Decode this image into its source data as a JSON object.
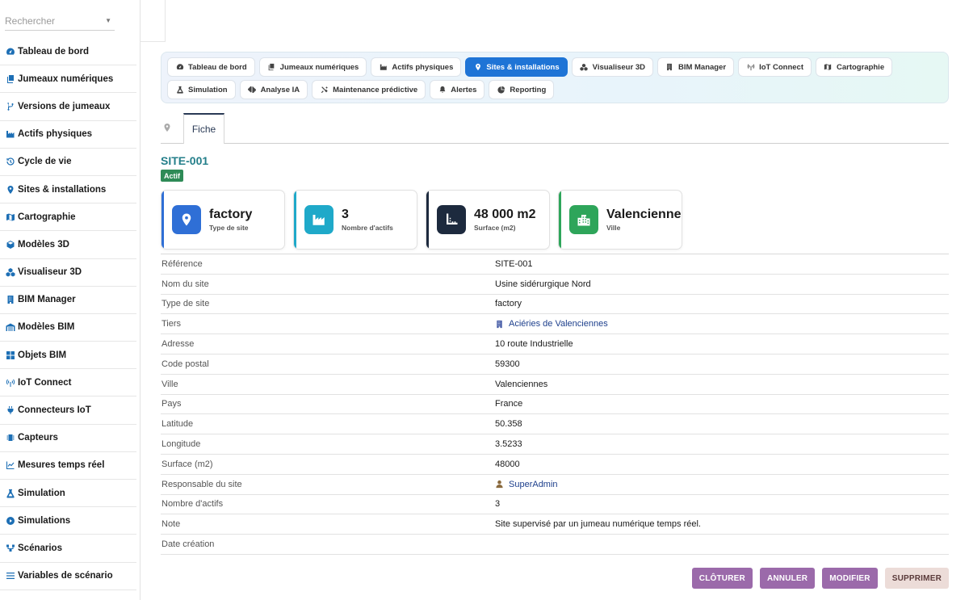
{
  "sidebar": {
    "search_placeholder": "Rechercher",
    "items": [
      {
        "label": "Tableau de bord",
        "icon": "gauge-icon"
      },
      {
        "label": "Jumeaux numériques",
        "icon": "copy-icon"
      },
      {
        "label": "Versions de jumeaux",
        "icon": "branch-icon"
      },
      {
        "label": "Actifs physiques",
        "icon": "industry-icon"
      },
      {
        "label": "Cycle de vie",
        "icon": "history-icon"
      },
      {
        "label": "Sites & installations",
        "icon": "map-pin-icon"
      },
      {
        "label": "Cartographie",
        "icon": "map-icon"
      },
      {
        "label": "Modèles 3D",
        "icon": "cube-icon"
      },
      {
        "label": "Visualiseur 3D",
        "icon": "cubes-icon"
      },
      {
        "label": "BIM Manager",
        "icon": "building-icon"
      },
      {
        "label": "Modèles BIM",
        "icon": "warehouse-icon"
      },
      {
        "label": "Objets BIM",
        "icon": "grid-icon"
      },
      {
        "label": "IoT Connect",
        "icon": "antenna-icon"
      },
      {
        "label": "Connecteurs IoT",
        "icon": "plug-icon"
      },
      {
        "label": "Capteurs",
        "icon": "chip-icon"
      },
      {
        "label": "Mesures temps réel",
        "icon": "line-chart-icon"
      },
      {
        "label": "Simulation",
        "icon": "flask-icon"
      },
      {
        "label": "Simulations",
        "icon": "play-circle-icon"
      },
      {
        "label": "Scénarios",
        "icon": "project-icon"
      },
      {
        "label": "Variables de scénario",
        "icon": "sliders-icon"
      }
    ]
  },
  "module_tabs": [
    {
      "label": "Tableau de bord",
      "icon": "gauge-icon",
      "active": false
    },
    {
      "label": "Jumeaux numériques",
      "icon": "copy-icon",
      "active": false
    },
    {
      "label": "Actifs physiques",
      "icon": "industry-icon",
      "active": false
    },
    {
      "label": "Sites & installations",
      "icon": "map-pin-icon",
      "active": true
    },
    {
      "label": "Visualiseur 3D",
      "icon": "cubes-icon",
      "active": false
    },
    {
      "label": "BIM Manager",
      "icon": "building-icon",
      "active": false
    },
    {
      "label": "IoT Connect",
      "icon": "antenna-icon",
      "active": false
    },
    {
      "label": "Cartographie",
      "icon": "map-icon",
      "active": false
    },
    {
      "label": "Simulation",
      "icon": "flask-icon",
      "active": false
    },
    {
      "label": "Analyse IA",
      "icon": "brain-icon",
      "active": false
    },
    {
      "label": "Maintenance prédictive",
      "icon": "tools-icon",
      "active": false
    },
    {
      "label": "Alertes",
      "icon": "bell-icon",
      "active": false
    },
    {
      "label": "Reporting",
      "icon": "pie-chart-icon",
      "active": false
    }
  ],
  "record_tabs": {
    "fiche": "Fiche"
  },
  "record": {
    "ref": "SITE-001",
    "status": "Actif"
  },
  "cards": [
    {
      "value": "factory",
      "label": "Type de site",
      "icon": "map-pin-icon",
      "color": "#2f6fd6",
      "bar": "#2f6fd6"
    },
    {
      "value": "3",
      "label": "Nombre d'actifs",
      "icon": "industry-icon",
      "color": "#1fa9c9",
      "bar": "#1fa9c9"
    },
    {
      "value": "48 000 m2",
      "label": "Surface (m2)",
      "icon": "ruler-icon",
      "color": "#1d2a3e",
      "bar": "#1d2a3e"
    },
    {
      "value": "Valenciennes",
      "label": "Ville",
      "icon": "city-icon",
      "color": "#2ea55a",
      "bar": "#2ea55a"
    }
  ],
  "fields": [
    {
      "label": "Référence",
      "value": "SITE-001"
    },
    {
      "label": "Nom du site",
      "value": "Usine sidérurgique Nord"
    },
    {
      "label": "Type de site",
      "value": "factory"
    },
    {
      "label": "Tiers",
      "value": "Aciéries de Valenciennes",
      "link": true,
      "icon": "building-icon"
    },
    {
      "label": "Adresse",
      "value": "10 route Industrielle"
    },
    {
      "label": "Code postal",
      "value": "59300"
    },
    {
      "label": "Ville",
      "value": "Valenciennes"
    },
    {
      "label": "Pays",
      "value": "France"
    },
    {
      "label": "Latitude",
      "value": "50.358"
    },
    {
      "label": "Longitude",
      "value": "3.5233"
    },
    {
      "label": "Surface (m2)",
      "value": "48000"
    },
    {
      "label": "Responsable du site",
      "value": "SuperAdmin",
      "link": true,
      "icon": "user-icon"
    },
    {
      "label": "Nombre d'actifs",
      "value": "3"
    },
    {
      "label": "Note",
      "value": "Site supervisé par un jumeau numérique temps réel."
    },
    {
      "label": "Date création",
      "value": ""
    }
  ],
  "actions": {
    "close": "CLÔTURER",
    "cancel": "ANNULER",
    "edit": "MODIFIER",
    "delete": "SUPPRIMER"
  }
}
